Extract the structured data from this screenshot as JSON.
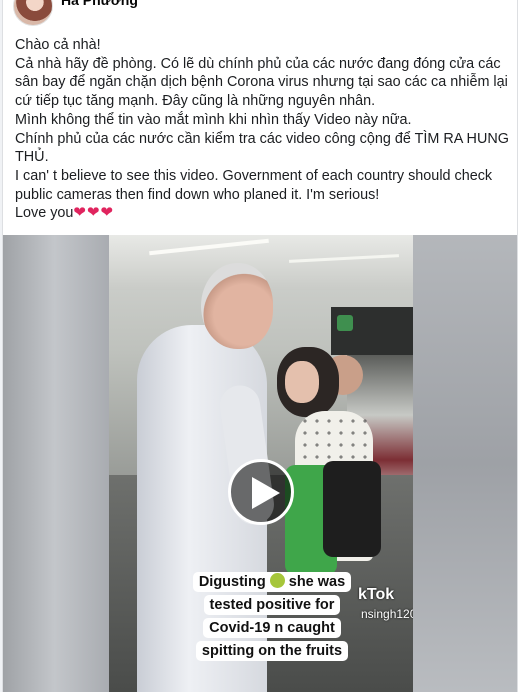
{
  "post": {
    "author_name": "Hà Phương",
    "text_lines": [
      "Chào cả nhà!",
      "Cả nhà hãy đề phòng. Có lẽ dù chính phủ của các nước đang đóng cửa các",
      "sân bay để ngăn chặn dịch bệnh Corona virus nhưng tại sao các ca nhiễm lại",
      "cứ tiếp tục tăng mạnh. Đây cũng là những nguyên nhân.",
      "Mình không thể tin vào mắt mình khi nhìn thấy Video này nữa.",
      "Chính phủ của các nước cần kiểm tra các video công cộng để TÌM RA HUNG",
      "THỦ.",
      "I can' t believe to see this video. Government of each country should check",
      "public cameras then find down who planed it. I'm serious!",
      "Love you"
    ],
    "hearts": "❤❤❤"
  },
  "video": {
    "caption_lines": [
      "Digusting",
      "she was",
      "tested positive for",
      "Covid-19 n caught",
      "spitting on the fruits"
    ],
    "watermark_logo": "kTok",
    "watermark_user": "nsingh120",
    "caption_emoji": "sick-face-emoji"
  }
}
